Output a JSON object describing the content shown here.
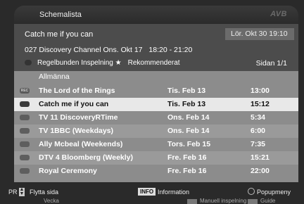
{
  "title": "Schemalista",
  "logo": "AVB",
  "info": {
    "program": "Catch me if you can",
    "datetime": "Lör. Okt 30   19:10",
    "channel": "027 Discovery Channel Ons. Okt 17",
    "timerange": "18:20 - 21:20",
    "legend_regular": "Regelbunden Inspelning",
    "legend_recommended": "Rekommenderat",
    "page": "Sidan 1/1"
  },
  "list": {
    "category": "Allmänna",
    "rows": [
      {
        "icon": "rec",
        "name": "The Lord of the Rings",
        "date": "Tis. Feb 13",
        "time": "13:00",
        "selected": false
      },
      {
        "icon": "dot",
        "name": "Catch me if you can",
        "date": "Tis. Feb 13",
        "time": "15:12",
        "selected": true
      },
      {
        "icon": "dot",
        "name": "TV  11 DiscoveryRTime",
        "date": "Ons. Feb 14",
        "time": "5:34",
        "selected": false
      },
      {
        "icon": "dot",
        "name": "TV  1BBC (Weekdays)",
        "date": "Ons. Feb 14",
        "time": "6:00",
        "selected": false
      },
      {
        "icon": "dot",
        "name": "Ally Mcbeal (Weekends)",
        "date": "Tors. Feb 15",
        "time": "7:35",
        "selected": false
      },
      {
        "icon": "dot",
        "name": "DTV 4 Bloomberg (Weekly)",
        "date": "Fre. Feb 16",
        "time": "15:21",
        "selected": false
      },
      {
        "icon": "dot",
        "name": "Royal Ceremony",
        "date": "Fre. Feb 16",
        "time": "22:00",
        "selected": false
      }
    ]
  },
  "footer": {
    "pr": "PR",
    "move_page": "Flytta sida",
    "info_btn": "INFO",
    "info_label": "Information",
    "popup": "Popupmeny",
    "select": "Vecka",
    "manual": "Manuell inspelning",
    "guide": "Guide"
  },
  "colors": {
    "background": "#2a2a2a",
    "panel": "#4c4c4c",
    "list": "#8c8c8c",
    "selected_row": "#e8e8e8"
  }
}
